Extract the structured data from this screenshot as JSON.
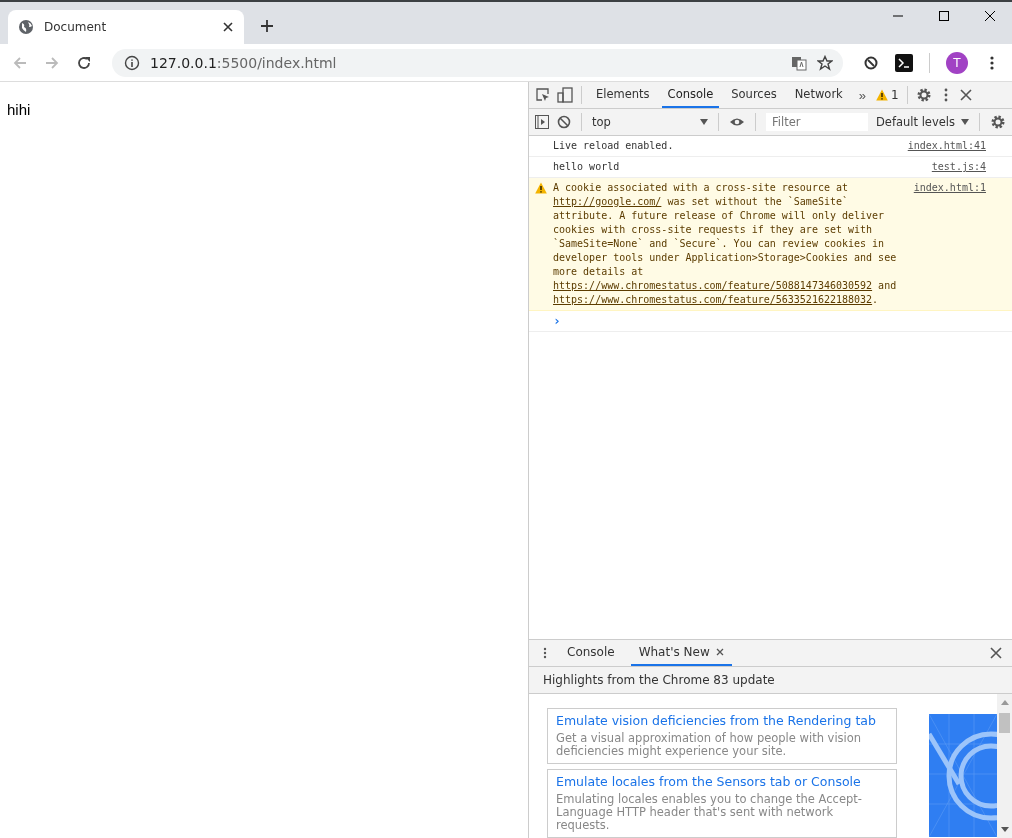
{
  "browser": {
    "tab_title": "Document",
    "address_host": "127.0.0.1",
    "address_path": ":5500/index.html",
    "avatar": "T"
  },
  "page": {
    "text": "hihi"
  },
  "devtools": {
    "tabs": [
      {
        "label": "Elements",
        "selected": false
      },
      {
        "label": "Console",
        "selected": true
      },
      {
        "label": "Sources",
        "selected": false
      },
      {
        "label": "Network",
        "selected": false
      }
    ],
    "more": "»",
    "warning_count": "1",
    "context": "top",
    "filter_placeholder": "Filter",
    "levels": "Default levels",
    "messages": [
      {
        "kind": "log",
        "parts": [
          {
            "kind": "text",
            "text": "Live reload enabled."
          }
        ],
        "source": "index.html:41"
      },
      {
        "kind": "log",
        "parts": [
          {
            "kind": "text",
            "text": "hello world"
          }
        ],
        "source": "test.js:4"
      },
      {
        "kind": "warning",
        "parts": [
          {
            "kind": "text",
            "text": "A cookie associated with a cross-site resource at "
          },
          {
            "kind": "link",
            "text": "http://google.com/"
          },
          {
            "kind": "text",
            "text": " was set without the `SameSite` attribute. A future release of Chrome will only deliver cookies with cross-site requests if they are set with `SameSite=None` and `Secure`. You can review cookies in developer tools under Application>Storage>Cookies and see more details at "
          },
          {
            "kind": "link",
            "text": "https://www.chromestatus.com/feature/5088147346030592"
          },
          {
            "kind": "text",
            "text": " and "
          },
          {
            "kind": "link",
            "text": "https://www.chromestatus.com/feature/5633521622188032"
          },
          {
            "kind": "text",
            "text": "."
          }
        ],
        "source": "index.html:1"
      }
    ],
    "prompt": "›"
  },
  "drawer": {
    "tabs": [
      {
        "label": "Console",
        "selected": false,
        "closable": false
      },
      {
        "label": "What's New",
        "selected": true,
        "closable": true
      }
    ],
    "heading": "Highlights from the Chrome 83 update",
    "cards": [
      {
        "title": "Emulate vision deficiencies from the Rendering tab",
        "description": "Get a visual approximation of how people with vision deficiencies might experience your site."
      },
      {
        "title": "Emulate locales from the Sensors tab or Console",
        "description": "Emulating locales enables you to change the Accept-Language HTTP header that's sent with network requests."
      }
    ]
  }
}
